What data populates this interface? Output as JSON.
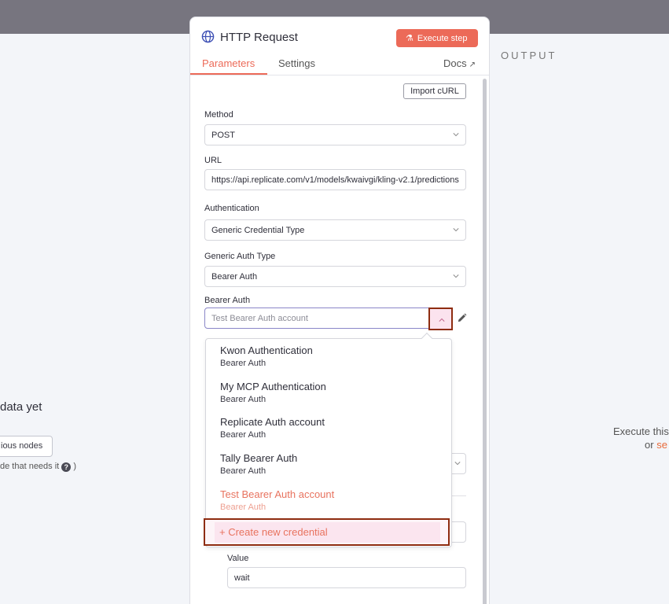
{
  "background": {
    "left": {
      "title_fragment": "data yet",
      "button_fragment": "ious nodes",
      "hint_fragment_before": "de that needs it",
      "hint_fragment_after": ")"
    },
    "output_label": "OUTPUT",
    "right": {
      "hint_line1": "Execute this",
      "hint_line2_prefix": "or",
      "hint_line2_link": "se"
    }
  },
  "panel": {
    "title": "HTTP Request",
    "execute_label": "Execute step",
    "tabs": [
      {
        "label": "Parameters",
        "active": true
      },
      {
        "label": "Settings",
        "active": false
      }
    ],
    "docs_label": "Docs",
    "import_curl": "Import cURL",
    "fields": {
      "method": {
        "label": "Method",
        "value": "POST"
      },
      "url": {
        "label": "URL",
        "value": "https://api.replicate.com/v1/models/kwaivgi/kling-v2.1/predictions"
      },
      "authentication": {
        "label": "Authentication",
        "value": "Generic Credential Type"
      },
      "generic_auth_type": {
        "label": "Generic Auth Type",
        "value": "Bearer Auth"
      },
      "bearer_auth": {
        "label": "Bearer Auth",
        "value": "Test Bearer Auth account"
      },
      "value": {
        "label": "Value",
        "value": "wait"
      }
    },
    "dropdown": {
      "items": [
        {
          "name": "Kwon Authentication",
          "type": "Bearer Auth"
        },
        {
          "name": "My MCP Authentication",
          "type": "Bearer Auth"
        },
        {
          "name": "Replicate Auth account",
          "type": "Bearer Auth"
        },
        {
          "name": "Tally Bearer Auth",
          "type": "Bearer Auth"
        },
        {
          "name": "Test Bearer Auth account",
          "type": "Bearer Auth"
        }
      ],
      "selected_index": 4,
      "create_label": "+ Create new credential"
    }
  },
  "colors": {
    "accent": "#ec6a58",
    "highlight_border": "#8e2c10",
    "topbar": "#77757f"
  }
}
